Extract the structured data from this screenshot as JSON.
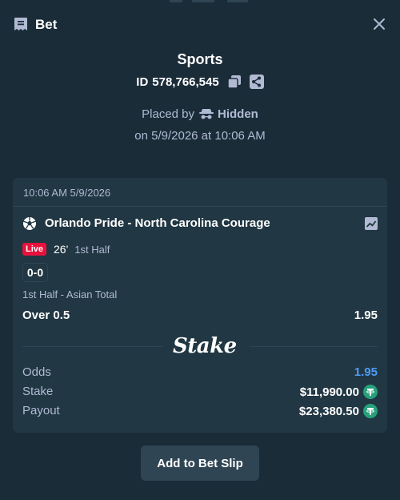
{
  "header": {
    "title": "Bet"
  },
  "bet": {
    "sport": "Sports",
    "id_label": "ID",
    "id_number": "578,766,545",
    "placed_by_label": "Placed by",
    "placed_by_user": "Hidden",
    "placed_on": "on 5/9/2026 at 10:06 AM"
  },
  "card": {
    "timestamp": "10:06 AM 5/9/2026",
    "match": "Orlando Pride - North Carolina Courage",
    "live_badge": "Live",
    "minute": "26'",
    "period": "1st Half",
    "score": "0-0",
    "market": "1st Half - Asian Total",
    "selection": "Over 0.5",
    "selection_odds": "1.95",
    "brand": "Stake",
    "odds_label": "Odds",
    "odds_value": "1.95",
    "stake_label": "Stake",
    "stake_value": "$11,990.00",
    "payout_label": "Payout",
    "payout_value": "$23,380.50"
  },
  "actions": {
    "add_label": "Add to Bet Slip"
  },
  "colors": {
    "background": "#1a2c38",
    "card": "#213743",
    "live": "#e9113c",
    "odds_accent": "#4f9cf7",
    "tether": "#26a17b"
  },
  "icons": [
    "bet-slip-icon",
    "close-icon",
    "copy-icon",
    "share-icon",
    "spy-icon",
    "soccer-ball-icon",
    "stats-icon",
    "tether-coin-icon"
  ]
}
